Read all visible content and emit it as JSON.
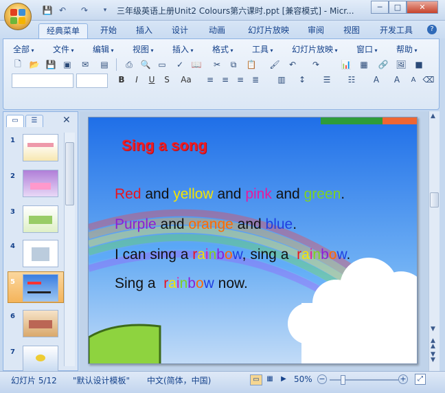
{
  "window": {
    "title": "三年级英语上册Unit2 Colours第六课时.ppt [兼容模式] - Micr...",
    "buttons": [
      "─",
      "□",
      "✕"
    ]
  },
  "ribbon_tabs": [
    "经典菜单",
    "开始",
    "插入",
    "设计",
    "动画",
    "幻灯片放映",
    "审阅",
    "视图",
    "开发工具"
  ],
  "active_tab": "经典菜单",
  "classic_menu": [
    "全部",
    "文件",
    "编辑",
    "视图",
    "插入",
    "格式",
    "工具",
    "幻灯片放映",
    "窗口",
    "帮助"
  ],
  "font_buttons": [
    "B",
    "I",
    "U",
    "S",
    "Aa"
  ],
  "panel": {
    "slide_numbers": [
      "1",
      "2",
      "3",
      "4",
      "5",
      "6",
      "7"
    ],
    "selected_slide": "5"
  },
  "slide": {
    "heading": "Sing a song",
    "line1": [
      {
        "t": "Red",
        "c": "#e8141e"
      },
      {
        "t": " and ",
        "c": "#111111"
      },
      {
        "t": "yellow",
        "c": "#f5e400"
      },
      {
        "t": " and ",
        "c": "#111111"
      },
      {
        "t": "pink",
        "c": "#e8199c"
      },
      {
        "t": " and ",
        "c": "#111111"
      },
      {
        "t": "green",
        "c": "#7ed321"
      },
      {
        "t": ".",
        "c": "#111111"
      }
    ],
    "line2": [
      {
        "t": "Purple",
        "c": "#8b1fd6"
      },
      {
        "t": " and ",
        "c": "#111111"
      },
      {
        "t": "orange",
        "c": "#ff6a00"
      },
      {
        "t": " and ",
        "c": "#111111"
      },
      {
        "t": "blue",
        "c": "#1f3fe0"
      },
      {
        "t": ".",
        "c": "#111111"
      }
    ],
    "line3": [
      {
        "t": "I can sing a ",
        "c": "#111111"
      },
      {
        "t": "r",
        "c": "#e8141e"
      },
      {
        "t": "a",
        "c": "#f5e400"
      },
      {
        "t": "i",
        "c": "#e8199c"
      },
      {
        "t": "n",
        "c": "#7ed321"
      },
      {
        "t": "b",
        "c": "#8b1fd6"
      },
      {
        "t": "o",
        "c": "#ff6a00"
      },
      {
        "t": "w",
        "c": "#1f3fe0"
      },
      {
        "t": ", sing a  ",
        "c": "#111111"
      },
      {
        "t": "r",
        "c": "#e8141e"
      },
      {
        "t": "a",
        "c": "#f5e400"
      },
      {
        "t": "i",
        "c": "#e8199c"
      },
      {
        "t": "n",
        "c": "#7ed321"
      },
      {
        "t": "b",
        "c": "#8b1fd6"
      },
      {
        "t": "o",
        "c": "#ff6a00"
      },
      {
        "t": "w",
        "c": "#1f3fe0"
      },
      {
        "t": ".",
        "c": "#111111"
      }
    ],
    "line4": [
      {
        "t": "Sing a  ",
        "c": "#111111"
      },
      {
        "t": "r",
        "c": "#e8141e"
      },
      {
        "t": "a",
        "c": "#f5e400"
      },
      {
        "t": "i",
        "c": "#e8199c"
      },
      {
        "t": "n",
        "c": "#7ed321"
      },
      {
        "t": "b",
        "c": "#8b1fd6"
      },
      {
        "t": "o",
        "c": "#ff6a00"
      },
      {
        "t": "w",
        "c": "#1f3fe0"
      },
      {
        "t": " now.",
        "c": "#111111"
      }
    ]
  },
  "status": {
    "slide_info": "幻灯片 5/12",
    "template": "\"默认设计模板\"",
    "language": "中文(简体，中国)",
    "zoom": "50%"
  }
}
